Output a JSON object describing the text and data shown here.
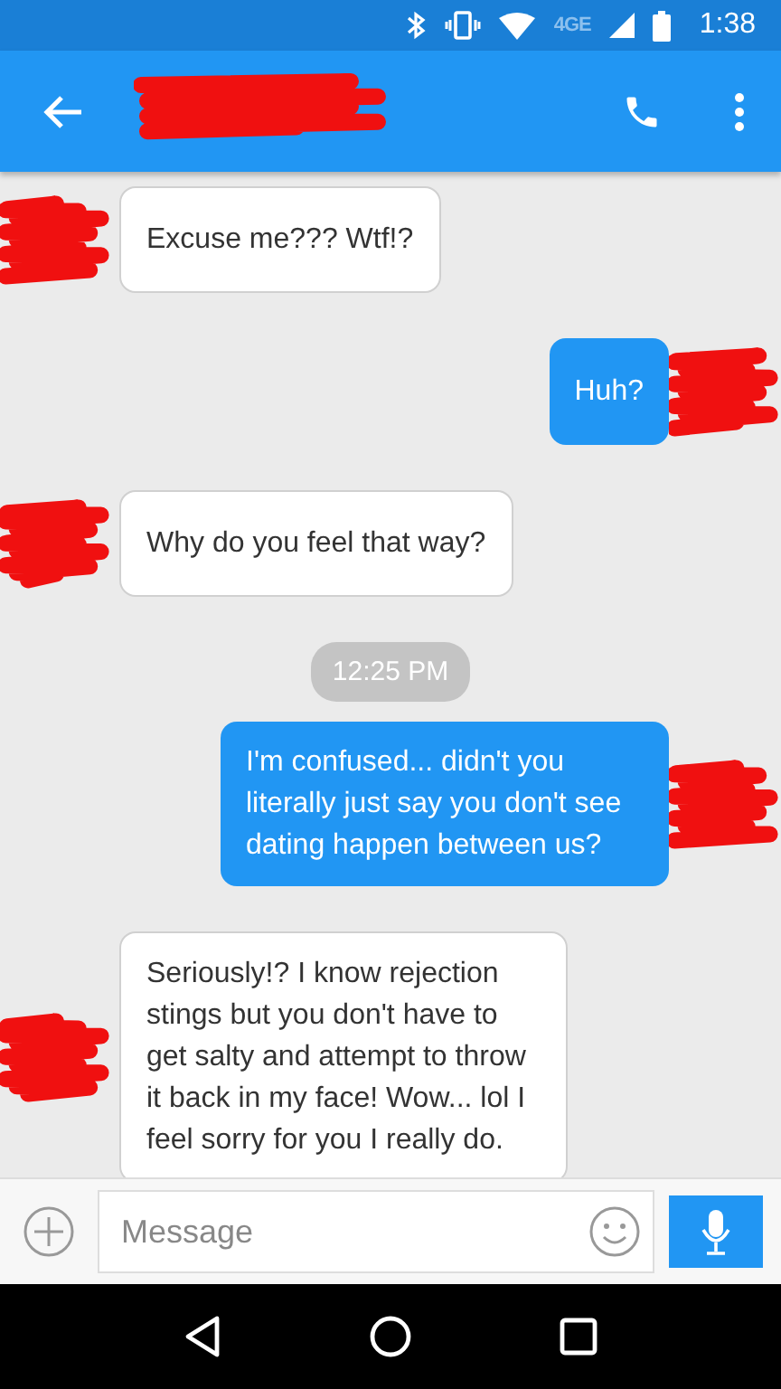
{
  "status_bar": {
    "network": "4GE",
    "time": "1:38"
  },
  "messages": [
    {
      "kind": "incoming",
      "text": "Excuse me??? Wtf!?"
    },
    {
      "kind": "outgoing",
      "text": "Huh?"
    },
    {
      "kind": "incoming",
      "text": "Why do you feel that way?"
    },
    {
      "kind": "timestamp",
      "text": "12:25 PM"
    },
    {
      "kind": "outgoing",
      "text": "I'm confused... didn't you literally just say you don't see dating happen between us?"
    },
    {
      "kind": "incoming",
      "text": "Seriously!? I know rejection stings but you don't have to get salty and attempt to throw it back in my face! Wow... lol I feel sorry for you I really do."
    }
  ],
  "composer": {
    "placeholder": "Message"
  }
}
